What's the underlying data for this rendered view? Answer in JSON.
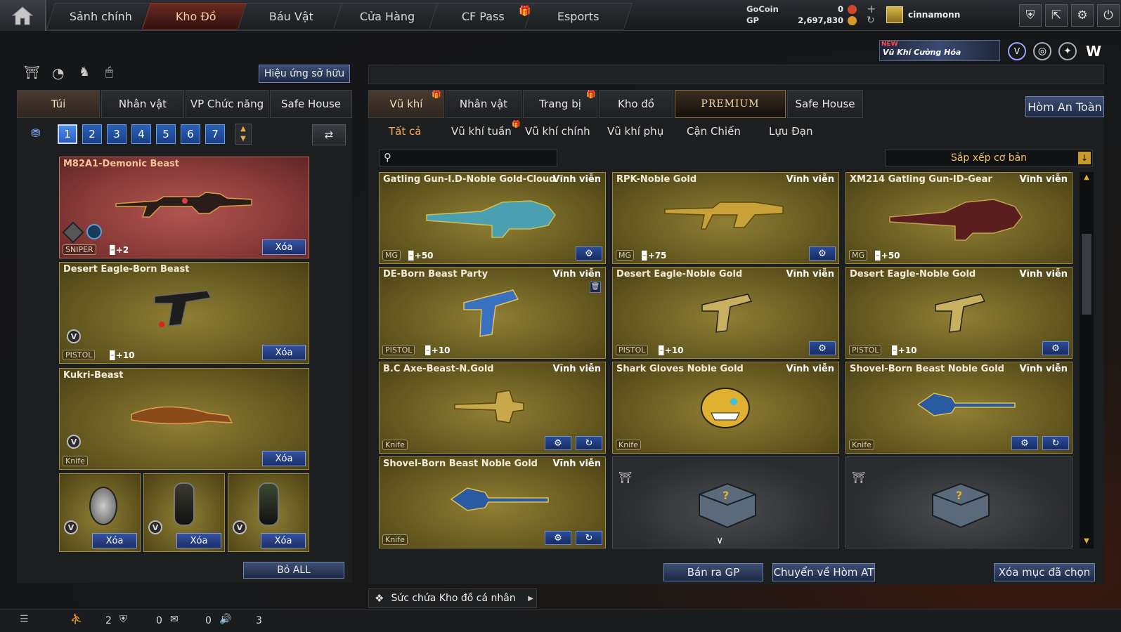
{
  "nav": {
    "tabs": [
      {
        "label": "Sảnh chính"
      },
      {
        "label": "Kho Đồ"
      },
      {
        "label": "Báu Vật"
      },
      {
        "label": "Cửa Hàng"
      },
      {
        "label": "CF Pass"
      },
      {
        "label": "Esports"
      }
    ]
  },
  "currency": {
    "gocoin_label": "GoCoin",
    "gocoin_value": "0",
    "gp_label": "GP",
    "gp_value": "2,697,830"
  },
  "user": {
    "name": "cinnamonn"
  },
  "promo": {
    "new_badge": "NEW",
    "text": "Vũ Khí Cường Hóa"
  },
  "left": {
    "effects_button": "Hiệu ứng sở hữu",
    "tabs": [
      {
        "label": "Túi"
      },
      {
        "label": "Nhân vật"
      },
      {
        "label": "VP Chức năng"
      },
      {
        "label": "Safe House"
      }
    ],
    "pages": [
      "1",
      "2",
      "3",
      "4",
      "5",
      "6",
      "7"
    ],
    "slots": [
      {
        "name": "M82A1-Demonic Beast",
        "category": "SNIPER",
        "bonus": "+2",
        "delete": "Xóa"
      },
      {
        "name": "Desert Eagle-Born Beast",
        "category": "PISTOL",
        "bonus": "+10",
        "delete": "Xóa"
      },
      {
        "name": "Kukri-Beast",
        "category": "Knife",
        "bonus": "",
        "delete": "Xóa"
      }
    ],
    "grenades": [
      {
        "delete": "Xóa"
      },
      {
        "delete": "Xóa"
      },
      {
        "delete": "Xóa"
      }
    ],
    "remove_all": "Bỏ ALL"
  },
  "right": {
    "tabs": [
      {
        "label": "Vũ khí"
      },
      {
        "label": "Nhân vật"
      },
      {
        "label": "Trang bị"
      },
      {
        "label": "Kho đồ"
      },
      {
        "label": "PREMIUM"
      },
      {
        "label": "Safe House"
      }
    ],
    "safe_box_button": "Hòm An Toàn",
    "subtabs": [
      {
        "label": "Tất cả"
      },
      {
        "label": "Vũ khí tuần"
      },
      {
        "label": "Vũ khí chính"
      },
      {
        "label": "Vũ khí phụ"
      },
      {
        "label": "Cận Chiến"
      },
      {
        "label": "Lựu Đạn"
      }
    ],
    "search_placeholder": "",
    "sort_label": "Sắp xếp cơ bản",
    "items": [
      {
        "name": "Gatling Gun-I.D-Noble Gold-Cloud",
        "duration": "Vĩnh viễn",
        "category": "MG",
        "bonus": "+50"
      },
      {
        "name": "RPK-Noble Gold",
        "duration": "Vĩnh viễn",
        "category": "MG",
        "bonus": "+75"
      },
      {
        "name": "XM214 Gatling Gun-ID-Gear",
        "duration": "Vĩnh viễn",
        "category": "MG",
        "bonus": "+50"
      },
      {
        "name": "DE-Born Beast Party",
        "duration": "Vĩnh viễn",
        "category": "PISTOL",
        "bonus": "+10"
      },
      {
        "name": "Desert Eagle-Noble Gold",
        "duration": "Vĩnh viễn",
        "category": "PISTOL",
        "bonus": "+10"
      },
      {
        "name": "Desert Eagle-Noble Gold",
        "duration": "Vĩnh viễn",
        "category": "PISTOL",
        "bonus": "+10"
      },
      {
        "name": "B.C Axe-Beast-N.Gold",
        "duration": "Vĩnh viễn",
        "category": "Knife",
        "bonus": ""
      },
      {
        "name": "Shark Gloves Noble Gold",
        "duration": "Vĩnh viễn",
        "category": "Knife",
        "bonus": ""
      },
      {
        "name": "Shovel-Born Beast Noble Gold",
        "duration": "Vĩnh viễn",
        "category": "Knife",
        "bonus": ""
      },
      {
        "name": "Shovel-Born Beast Noble Gold",
        "duration": "Vĩnh viễn",
        "category": "Knife",
        "bonus": ""
      }
    ],
    "sell_button": "Bán ra GP",
    "transfer_button": "Chuyển về Hòm AT",
    "delete_selected_button": "Xóa mục đã chọn",
    "capacity_label": "Sức chứa Kho đồ cá nhân"
  },
  "status": {
    "count1": "2",
    "count2": "0",
    "count3": "0",
    "count4": "3"
  }
}
